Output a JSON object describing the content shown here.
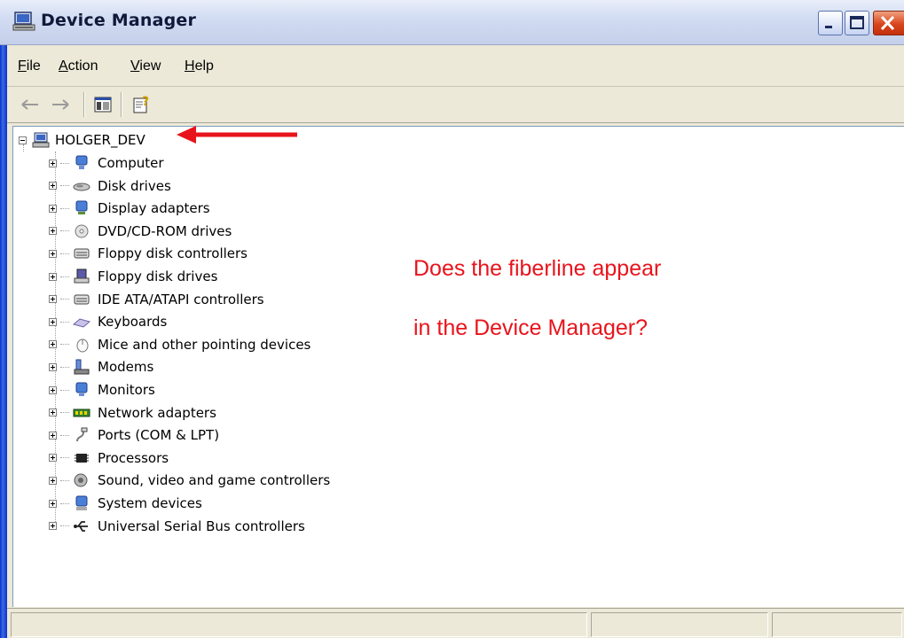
{
  "window": {
    "title": "Device Manager",
    "icon": "computer-monitor-icon"
  },
  "menu": {
    "items": [
      {
        "label": "File"
      },
      {
        "label": "Action"
      },
      {
        "label": "View"
      },
      {
        "label": "Help"
      }
    ]
  },
  "toolbar": {
    "buttons": [
      "back-arrow-icon",
      "forward-arrow-icon",
      "show-hide-console-tree-icon",
      "properties-help-icon"
    ]
  },
  "tree": {
    "root": {
      "label": "HOLGER_DEV",
      "icon": "computer-icon",
      "expanded": true
    },
    "items": [
      {
        "label": "Computer",
        "icon": "computer-icon"
      },
      {
        "label": "Disk drives",
        "icon": "disk-drive-icon"
      },
      {
        "label": "Display adapters",
        "icon": "display-adapter-icon"
      },
      {
        "label": "DVD/CD-ROM drives",
        "icon": "dvd-drive-icon"
      },
      {
        "label": "Floppy disk controllers",
        "icon": "controller-icon"
      },
      {
        "label": "Floppy disk drives",
        "icon": "floppy-drive-icon"
      },
      {
        "label": "IDE ATA/ATAPI controllers",
        "icon": "controller-icon"
      },
      {
        "label": "Keyboards",
        "icon": "keyboard-icon"
      },
      {
        "label": "Mice and other pointing devices",
        "icon": "mouse-icon"
      },
      {
        "label": "Modems",
        "icon": "modem-icon"
      },
      {
        "label": "Monitors",
        "icon": "monitor-icon"
      },
      {
        "label": "Network adapters",
        "icon": "network-adapter-icon"
      },
      {
        "label": "Ports (COM & LPT)",
        "icon": "port-icon"
      },
      {
        "label": "Processors",
        "icon": "processor-icon"
      },
      {
        "label": "Sound, video and game controllers",
        "icon": "sound-icon"
      },
      {
        "label": "System devices",
        "icon": "system-device-icon"
      },
      {
        "label": "Universal Serial Bus controllers",
        "icon": "usb-icon"
      }
    ]
  },
  "annotation": {
    "line1": "Does the fiberline appear",
    "line2": "in the Device Manager?",
    "color": "#e8141c"
  },
  "colors": {
    "title_bar": "#d2dcf2",
    "close_button": "#d8451c",
    "chrome": "#ece9d8"
  }
}
